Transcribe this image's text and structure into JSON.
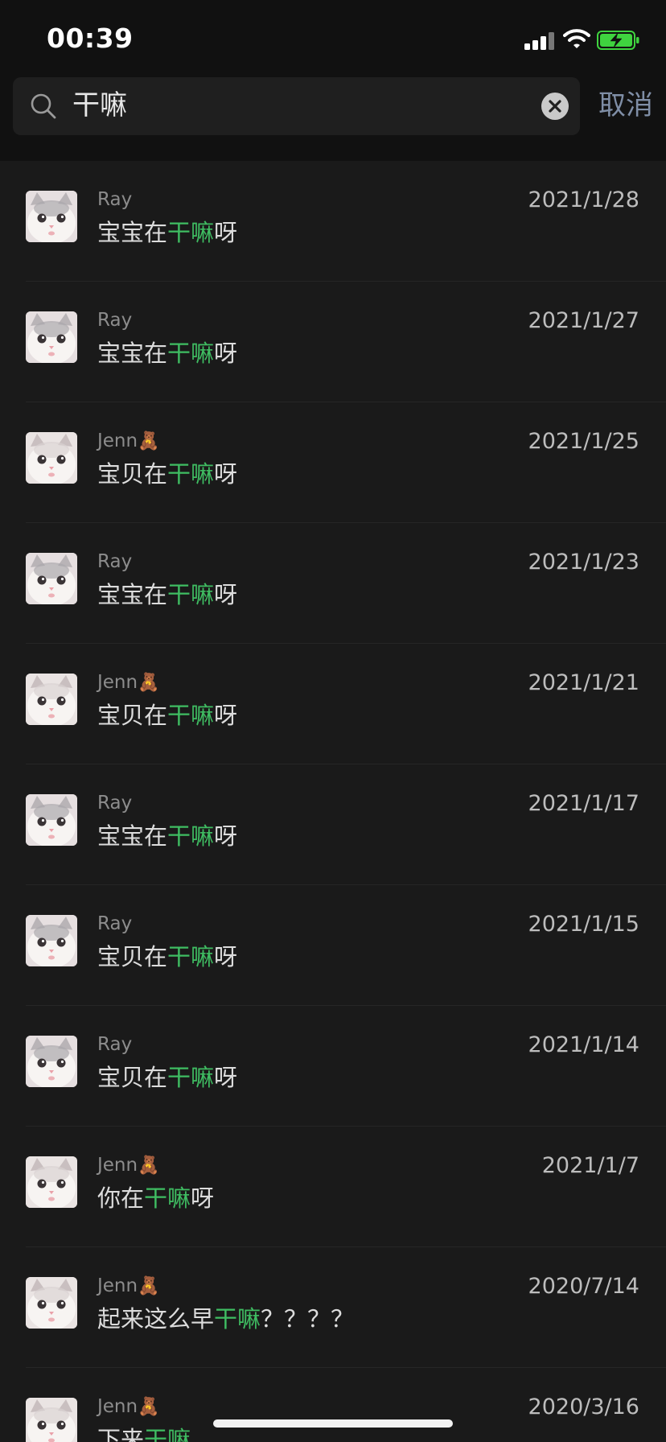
{
  "status_bar": {
    "time": "00:39"
  },
  "search": {
    "query": "干嘛",
    "cancel_label": "取消"
  },
  "results": [
    {
      "sender": "Ray",
      "sender_emoji": "",
      "msg_before": "宝宝在",
      "msg_highlight": "干嘛",
      "msg_after": "呀",
      "date": "2021/1/28"
    },
    {
      "sender": "Ray",
      "sender_emoji": "",
      "msg_before": "宝宝在",
      "msg_highlight": "干嘛",
      "msg_after": "呀",
      "date": "2021/1/27"
    },
    {
      "sender": "Jenn",
      "sender_emoji": "🧸",
      "msg_before": "宝贝在",
      "msg_highlight": "干嘛",
      "msg_after": "呀",
      "date": "2021/1/25"
    },
    {
      "sender": "Ray",
      "sender_emoji": "",
      "msg_before": "宝宝在",
      "msg_highlight": "干嘛",
      "msg_after": "呀",
      "date": "2021/1/23"
    },
    {
      "sender": "Jenn",
      "sender_emoji": "🧸",
      "msg_before": "宝贝在",
      "msg_highlight": "干嘛",
      "msg_after": "呀",
      "date": "2021/1/21"
    },
    {
      "sender": "Ray",
      "sender_emoji": "",
      "msg_before": "宝宝在",
      "msg_highlight": "干嘛",
      "msg_after": "呀",
      "date": "2021/1/17"
    },
    {
      "sender": "Ray",
      "sender_emoji": "",
      "msg_before": "宝贝在",
      "msg_highlight": "干嘛",
      "msg_after": "呀",
      "date": "2021/1/15"
    },
    {
      "sender": "Ray",
      "sender_emoji": "",
      "msg_before": "宝贝在",
      "msg_highlight": "干嘛",
      "msg_after": "呀",
      "date": "2021/1/14"
    },
    {
      "sender": "Jenn",
      "sender_emoji": "🧸",
      "msg_before": "你在",
      "msg_highlight": "干嘛",
      "msg_after": "呀",
      "date": "2021/1/7"
    },
    {
      "sender": "Jenn",
      "sender_emoji": "🧸",
      "msg_before": "起来这么早",
      "msg_highlight": "干嘛",
      "msg_after": "？？？？",
      "date": "2020/7/14"
    },
    {
      "sender": "Jenn",
      "sender_emoji": "🧸",
      "msg_before": "下来",
      "msg_highlight": "干嘛",
      "msg_after": "",
      "date": "2020/3/16"
    }
  ],
  "colors": {
    "highlight": "#3fbd62",
    "cancel": "#7f8ea6",
    "background": "#1a1a1a",
    "header": "#111111"
  },
  "icons": [
    "signal-icon",
    "wifi-icon",
    "battery-charging-icon",
    "search-icon",
    "clear-icon",
    "cat-avatar"
  ]
}
